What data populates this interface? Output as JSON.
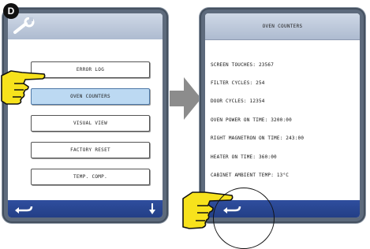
{
  "step_label": "D",
  "left_panel": {
    "menu_items": [
      "ERROR LOG",
      "OVEN COUNTERS",
      "VISUAL VIEW",
      "FACTORY RESET",
      "TEMP. COMP."
    ],
    "selected_item": "OVEN COUNTERS"
  },
  "right_panel": {
    "title": "OVEN COUNTERS",
    "lines": [
      "SCREEN TOUCHES: 23567",
      "FILTER CYCLES: 254",
      "DOOR CYCLES: 12354",
      "OVEN POWER ON TIME: 3200:00",
      "RIGHT MAGNETRON ON TIME: 243:00",
      "HEATER ON TIME: 360:00",
      "CABINET AMBIENT TEMP: 13°C"
    ]
  },
  "colors": {
    "bezel": "#5d6a7c",
    "topbar": "#aebbd0",
    "bottombar": "#233f86",
    "selected_button": "#bcd9f2",
    "hand": "#f7e21c"
  },
  "icons": [
    "wrench-icon",
    "back-arrow-icon",
    "down-arrow-icon",
    "right-arrow-icon",
    "pointing-hand-icon"
  ]
}
